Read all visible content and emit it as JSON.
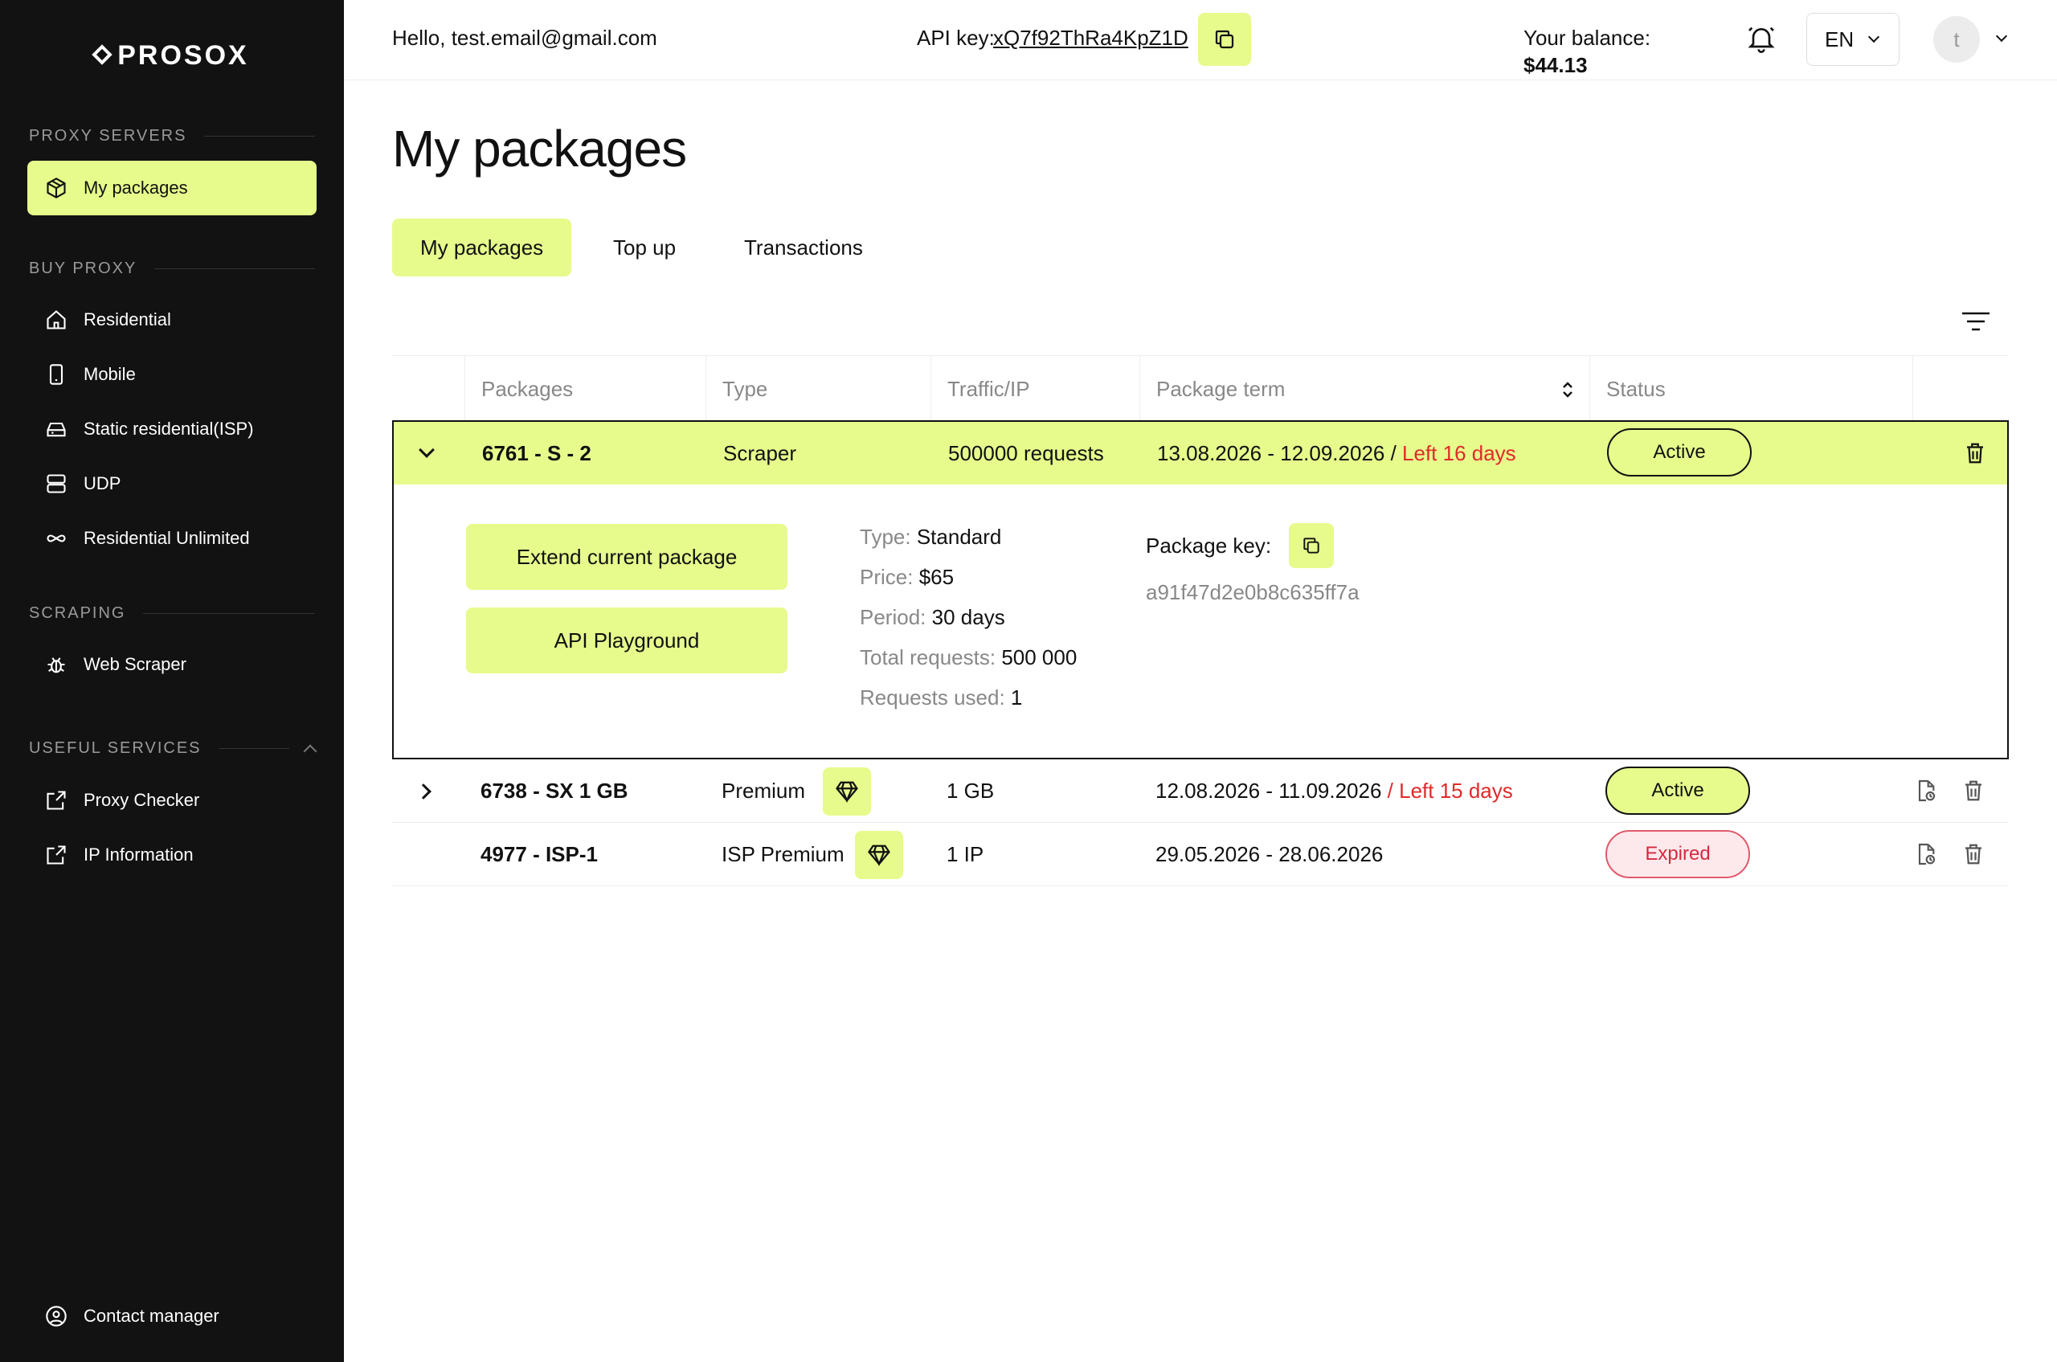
{
  "brand": {
    "name": "PROSOX"
  },
  "sidebar": {
    "sections": [
      {
        "title": "PROXY SERVERS"
      },
      {
        "title": "BUY PROXY"
      },
      {
        "title": "SCRAPING"
      },
      {
        "title": "USEFUL SERVICES"
      }
    ],
    "items": {
      "my_packages": "My packages",
      "residential": "Residential",
      "mobile": "Mobile",
      "static_isp": "Static residential(ISP)",
      "udp": "UDP",
      "residential_unlimited": "Residential Unlimited",
      "web_scraper": "Web Scraper",
      "proxy_checker": "Proxy Checker",
      "ip_information": "IP Information",
      "contact_manager": "Contact manager"
    }
  },
  "header": {
    "greeting": "Hello, test.email@gmail.com",
    "api_key_label": "API key:",
    "api_key_value": "xQ7f92ThRa4KpZ1D",
    "balance_label": "Your balance:",
    "balance_value": "$44.13",
    "language": "EN",
    "avatar_initial": "t"
  },
  "page": {
    "title": "My packages",
    "tabs": [
      "My packages",
      "Top up",
      "Transactions"
    ],
    "active_tab": "My packages"
  },
  "table": {
    "columns": [
      "Packages",
      "Type",
      "Traffic/IP",
      "Package term",
      "Status"
    ],
    "rows": [
      {
        "package": "6761 - S - 2",
        "type": "Scraper",
        "traffic": "500000 requests",
        "term": "13.08.2026 - 12.09.2026",
        "separator": " / ",
        "left": "Left 16 days",
        "status": "Active",
        "expanded": true
      },
      {
        "package": "6738 - SX 1 GB",
        "type": "Premium",
        "traffic": "1 GB",
        "term": "12.08.2026 - 11.09.2026",
        "separator": " / ",
        "left": "Left 15 days",
        "status": "Active",
        "expanded": false
      },
      {
        "package": "4977 - ISP-1",
        "type": "ISP Premium",
        "traffic": "1 IP",
        "term": "29.05.2026 - 28.06.2026",
        "separator": "",
        "left": "",
        "status": "Expired",
        "expanded": false
      }
    ],
    "details": {
      "extend_label": "Extend current package",
      "playground_label": "API Playground",
      "type_label": "Type:",
      "type_value": "Standard",
      "price_label": "Price:",
      "price_value": "$65",
      "period_label": "Period:",
      "period_value": "30 days",
      "total_label": "Total requests:",
      "total_value": "500 000",
      "used_label": "Requests used:",
      "used_value": "1",
      "key_label": "Package key:",
      "key_value": "a91f47d2e0b8c635ff7a"
    }
  },
  "colors": {
    "accent": "#e6fb8c",
    "sidebar_bg": "#121212",
    "danger": "#e02a2a"
  }
}
